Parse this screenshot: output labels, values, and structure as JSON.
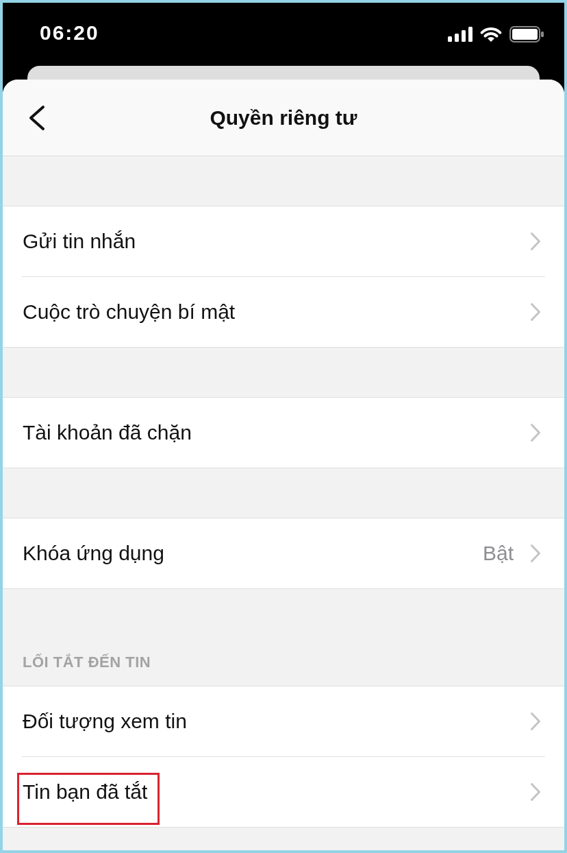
{
  "status_bar": {
    "time": "06:20"
  },
  "header": {
    "title": "Quyền riêng tư"
  },
  "sections": [
    {
      "items": [
        {
          "label": "Gửi tin nhắn",
          "highlighted": false
        },
        {
          "label": "Cuộc trò chuyện bí mật",
          "highlighted": false
        }
      ]
    },
    {
      "items": [
        {
          "label": "Tài khoản đã chặn",
          "highlighted": false
        }
      ]
    },
    {
      "items": [
        {
          "label": "Khóa ứng dụng",
          "value": "Bật",
          "highlighted": false
        }
      ]
    },
    {
      "header": "LỐI TẮT ĐẾN TIN",
      "items": [
        {
          "label": "Đối tượng xem tin",
          "highlighted": false
        },
        {
          "label": "Tin bạn đã tắt",
          "highlighted": true
        }
      ]
    }
  ]
}
